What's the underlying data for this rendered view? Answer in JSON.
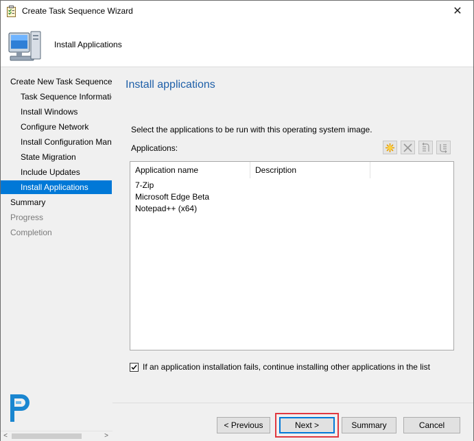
{
  "window": {
    "title": "Create Task Sequence Wizard",
    "close_glyph": "✕"
  },
  "header": {
    "title": "Install Applications",
    "icon": "computer-icon"
  },
  "sidebar": {
    "items": [
      {
        "label": "Create New Task Sequence",
        "level": "top",
        "state": "normal"
      },
      {
        "label": "Task Sequence Information",
        "level": "sub",
        "state": "normal"
      },
      {
        "label": "Install Windows",
        "level": "sub",
        "state": "normal"
      },
      {
        "label": "Configure Network",
        "level": "sub",
        "state": "normal"
      },
      {
        "label": "Install Configuration Manager",
        "level": "sub",
        "state": "normal"
      },
      {
        "label": "State Migration",
        "level": "sub",
        "state": "normal"
      },
      {
        "label": "Include Updates",
        "level": "sub",
        "state": "normal"
      },
      {
        "label": "Install Applications",
        "level": "sub",
        "state": "selected"
      },
      {
        "label": "Summary",
        "level": "top",
        "state": "normal"
      },
      {
        "label": "Progress",
        "level": "top",
        "state": "disabled"
      },
      {
        "label": "Completion",
        "level": "top",
        "state": "disabled"
      }
    ],
    "scroll_left_glyph": "<",
    "scroll_right_glyph": ">"
  },
  "main": {
    "heading": "Install applications",
    "instruction": "Select the applications to be run with this operating system image.",
    "apps_label": "Applications:",
    "toolbar": [
      {
        "name": "new-icon"
      },
      {
        "name": "delete-icon"
      },
      {
        "name": "move-up-icon"
      },
      {
        "name": "move-down-icon"
      }
    ],
    "columns": [
      "Application name",
      "Description"
    ],
    "rows": [
      {
        "name": "7-Zip",
        "description": ""
      },
      {
        "name": "Microsoft Edge Beta",
        "description": ""
      },
      {
        "name": "Notepad++ (x64)",
        "description": ""
      }
    ],
    "continue_checkbox": {
      "checked": true,
      "label": "If an application installation fails, continue installing other applications in the list"
    }
  },
  "footer": {
    "previous": "< Previous",
    "next": "Next >",
    "summary": "Summary",
    "cancel": "Cancel"
  },
  "colors": {
    "accent": "#0078d7",
    "heading": "#1e5fa8",
    "highlight": "#e0373f",
    "panel": "#f0f0f0"
  }
}
